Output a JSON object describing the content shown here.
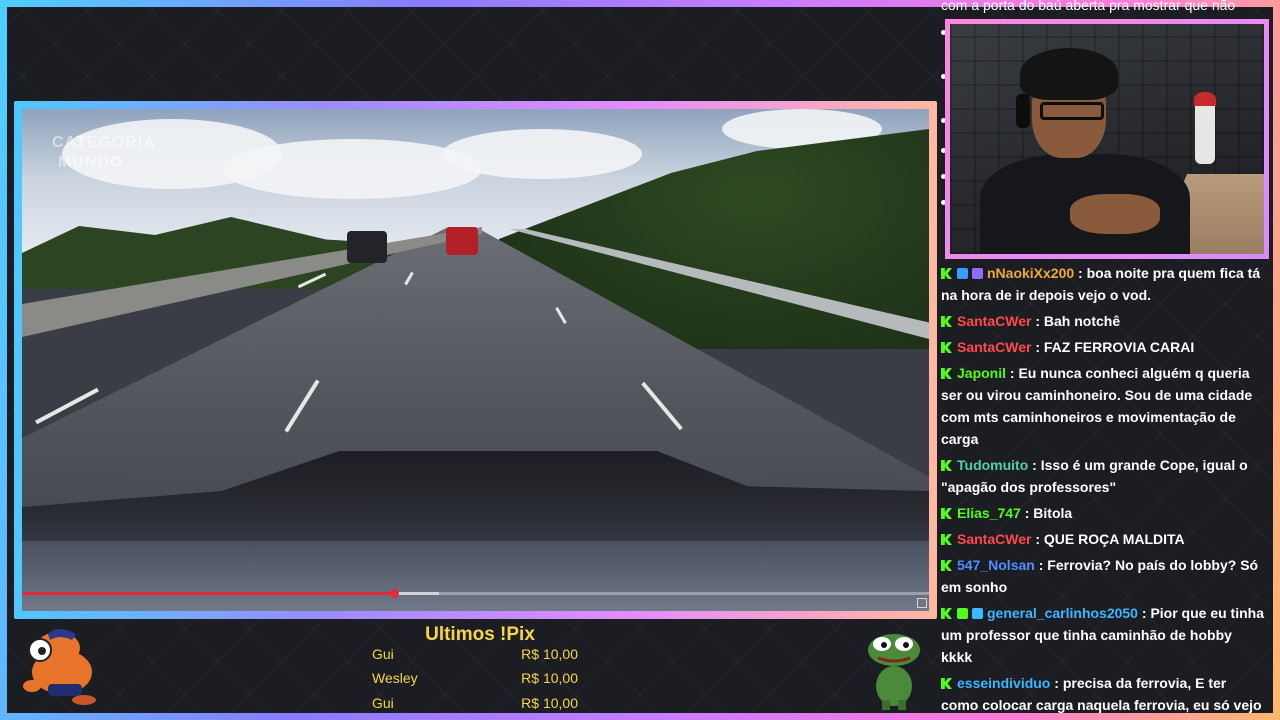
{
  "video": {
    "watermark_line1": "CATEGORIA",
    "watermark_line2": "MUNDO",
    "progress_played": 0.41,
    "progress_buffered": 0.46
  },
  "chat_top_partial": "com a porta do baú aberta pra mostrar que não",
  "chat": [
    {
      "user": "nNaokiXx200",
      "color": "#f0a93a",
      "extra_badges": [
        "#3b9bff",
        "#8f6bff"
      ],
      "text": "boa noite pra quem fica tá na hora de ir depois vejo o vod."
    },
    {
      "user": "SantaCWer",
      "color": "#ff4a4a",
      "extra_badges": [],
      "text": "Bah notchê"
    },
    {
      "user": "SantaCWer",
      "color": "#ff4a4a",
      "extra_badges": [],
      "text": "FAZ FERROVIA CARAI"
    },
    {
      "user": "Japonil",
      "color": "#53fc18",
      "extra_badges": [],
      "text": "Eu nunca conheci alguém q queria ser ou virou caminhoneiro. Sou de uma cidade com mts caminhoneiros e movimentação de carga"
    },
    {
      "user": "Tudomuito",
      "color": "#4fd2a8",
      "extra_badges": [],
      "text": "Isso é um grande Cope, igual o \"apagão dos professores\""
    },
    {
      "user": "Elias_747",
      "color": "#53fc18",
      "extra_badges": [],
      "text": "Bitola"
    },
    {
      "user": "SantaCWer",
      "color": "#ff4a4a",
      "extra_badges": [],
      "text": "QUE ROÇA MALDITA"
    },
    {
      "user": "547_Nolsan",
      "color": "#4f8cff",
      "extra_badges": [],
      "text": "Ferrovia? No país do lobby? Só em sonho"
    },
    {
      "user": "general_carlinhos2050",
      "color": "#3bb7ff",
      "extra_badges": [
        "#53fc18",
        "#3bb7ff"
      ],
      "text": "Pior que eu tinha um professor que tinha caminhão de hobby kkkk"
    },
    {
      "user": "esseindividuo",
      "color": "#3bb7ff",
      "extra_badges": [],
      "text": "precisa da ferrovia, E ter como colocar carga naquela ferrovia, eu só vejo transportando combustível e minério aqui"
    }
  ],
  "pix": {
    "title": "Ultimos !Pix",
    "rows": [
      {
        "name": "Gui",
        "amount": "R$ 10,00"
      },
      {
        "name": "Wesley",
        "amount": "R$ 10,00"
      },
      {
        "name": "Gui",
        "amount": "R$ 10,00"
      }
    ]
  },
  "icons": {
    "chat_badge": "kick-badge-icon",
    "left_mascot": "mascot-character-icon",
    "right_mascot": "pepe-frog-icon"
  },
  "colors": {
    "accent_yellow": "#f5d64a",
    "kick_green": "#53fc18",
    "frame_gradient": [
      "#4fd0ff",
      "#8a7bff",
      "#c77dff",
      "#ff7ad9",
      "#ffb86b"
    ]
  }
}
